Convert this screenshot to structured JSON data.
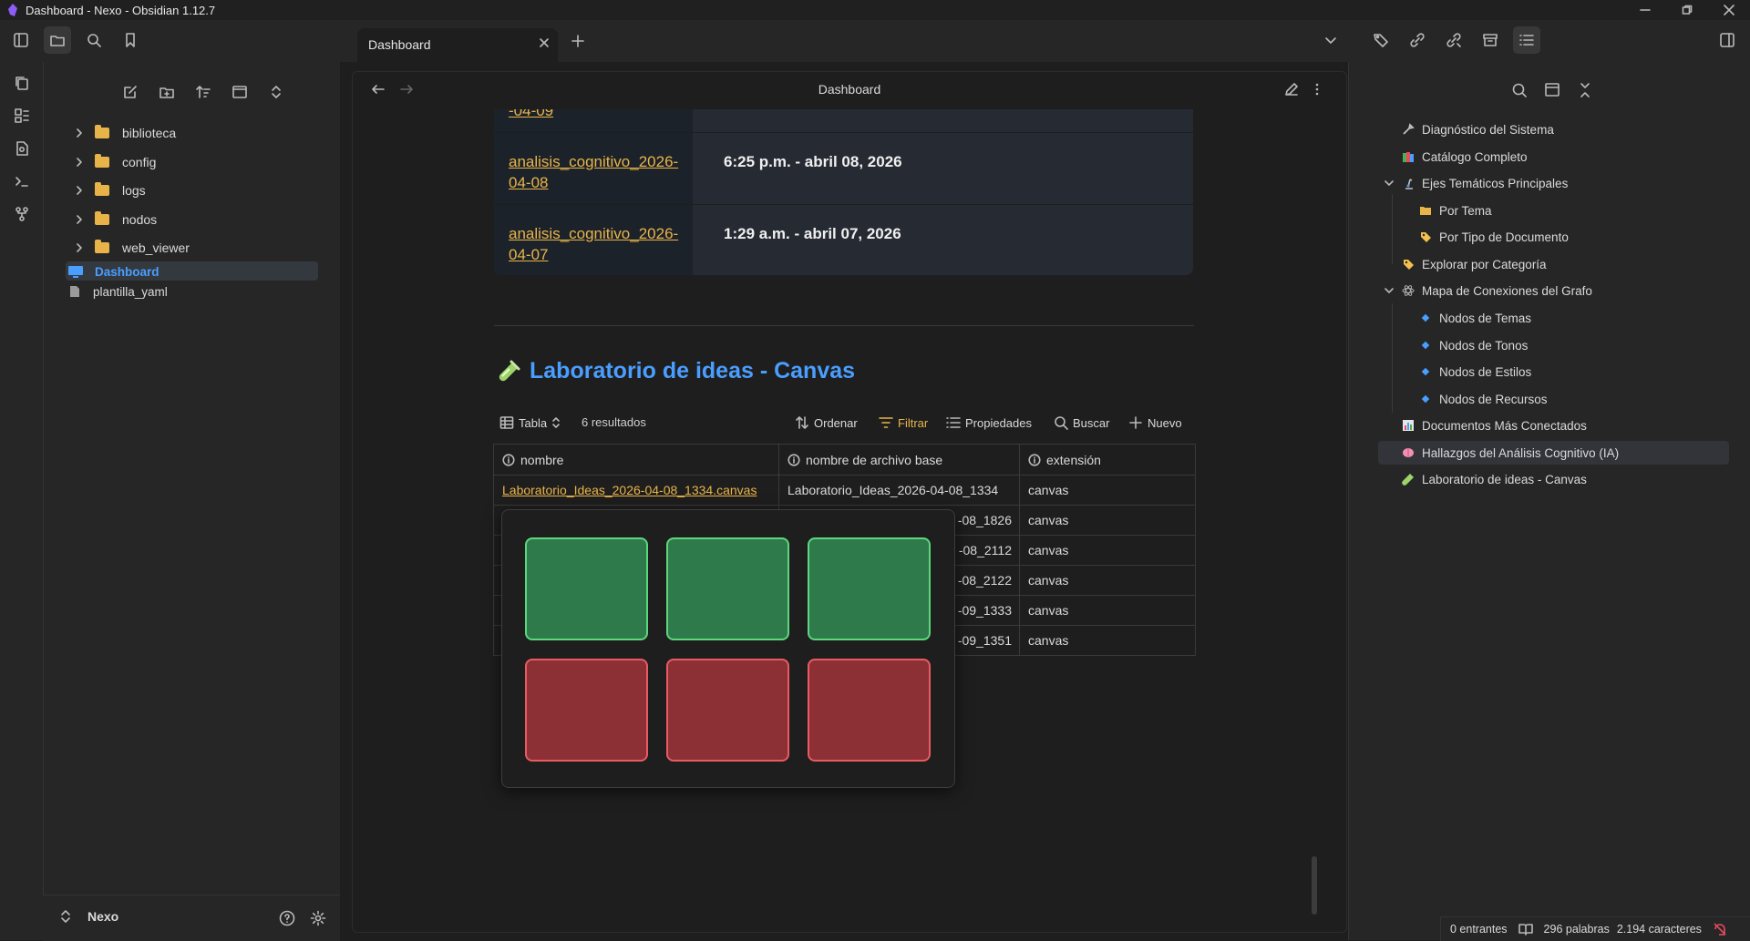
{
  "window": {
    "title": "Dashboard - Nexo - Obsidian 1.12.7"
  },
  "tabs": [
    {
      "label": "Dashboard"
    }
  ],
  "file_tree": {
    "folders": [
      "biblioteca",
      "config",
      "logs",
      "nodos",
      "web_viewer"
    ],
    "files": [
      {
        "label": "Dashboard",
        "active": true
      },
      {
        "label": "plantilla_yaml"
      }
    ]
  },
  "vault": {
    "name": "Nexo"
  },
  "view": {
    "title": "Dashboard"
  },
  "analysis_table": {
    "clipped_top_label": "-04-09",
    "rows": [
      {
        "link": "analisis_cognitivo_2026-04-08",
        "date": "6:25 p.m. - abril 08, 2026"
      },
      {
        "link": "analisis_cognitivo_2026-04-07",
        "date": "1:29 a.m. - abril 07, 2026"
      }
    ]
  },
  "section": {
    "emoji": "test-tube-icon",
    "heading": "Laboratorio de ideas - Canvas"
  },
  "bases_toolbar": {
    "view_label": "Tabla",
    "results": "6 resultados",
    "sort": "Ordenar",
    "filter": "Filtrar",
    "properties": "Propiedades",
    "search": "Buscar",
    "new": "Nuevo"
  },
  "data_table": {
    "columns": [
      "nombre",
      "nombre de archivo base",
      "extensión"
    ],
    "rows": [
      {
        "nombre": "Laboratorio_Ideas_2026-04-08_1334.canvas",
        "base": "Laboratorio_Ideas_2026-04-08_1334",
        "ext": "canvas"
      },
      {
        "nombre": "",
        "base": "-08_1826",
        "ext": "canvas"
      },
      {
        "nombre": "",
        "base": "-08_2112",
        "ext": "canvas"
      },
      {
        "nombre": "",
        "base": "-08_2122",
        "ext": "canvas"
      },
      {
        "nombre": "",
        "base": "-09_1333",
        "ext": "canvas"
      },
      {
        "nombre": "",
        "base": "-09_1351",
        "ext": "canvas"
      }
    ]
  },
  "preview": {
    "cards": [
      {
        "color": "green"
      },
      {
        "color": "green"
      },
      {
        "color": "green"
      },
      {
        "color": "red"
      },
      {
        "color": "red"
      },
      {
        "color": "red"
      }
    ]
  },
  "outline": {
    "items": [
      {
        "label": "Diagnóstico del Sistema",
        "icon": "tools-icon"
      },
      {
        "label": "Catálogo Completo",
        "icon": "books-icon"
      },
      {
        "label": "Ejes Temáticos Principales",
        "icon": "microscope-icon"
      },
      {
        "label": "Por Tema",
        "icon": "folder-icon"
      },
      {
        "label": "Por Tipo de Documento",
        "icon": "tag-icon"
      },
      {
        "label": "Explorar por Categoría",
        "icon": "tag-icon"
      },
      {
        "label": "Mapa de Conexiones del Grafo",
        "icon": "atom-icon"
      },
      {
        "label": "Nodos de Temas",
        "icon": "diamond-icon"
      },
      {
        "label": "Nodos de Tonos",
        "icon": "diamond-icon"
      },
      {
        "label": "Nodos de Estilos",
        "icon": "diamond-icon"
      },
      {
        "label": "Nodos de Recursos",
        "icon": "diamond-icon"
      },
      {
        "label": "Documentos Más Conectados",
        "icon": "chart-icon"
      },
      {
        "label": "Hallazgos del Análisis Cognitivo (IA)",
        "icon": "brain-icon"
      },
      {
        "label": "Laboratorio de ideas - Canvas",
        "icon": "test-tube-icon"
      }
    ]
  },
  "status": {
    "backlinks": "0 entrantes",
    "words": "296 palabras",
    "chars": "2.194 caracteres"
  },
  "colors": {
    "accent": "#4a9eff",
    "link": "#e8b44a",
    "card_green": "#2f7a4a",
    "card_red": "#8c3035"
  }
}
